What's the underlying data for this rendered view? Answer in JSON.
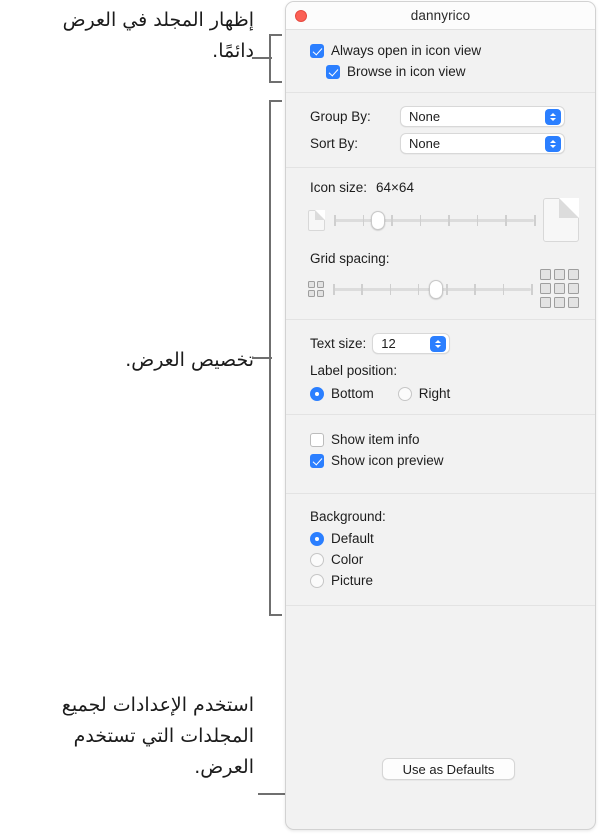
{
  "window": {
    "title": "dannyrico",
    "close_icon": "close-button-red"
  },
  "view_options": {
    "always_open_icon_view": {
      "label": "Always open in icon view",
      "checked": true
    },
    "browse_icon_view": {
      "label": "Browse in icon view",
      "checked": true
    },
    "group_by": {
      "label": "Group By:",
      "value": "None"
    },
    "sort_by": {
      "label": "Sort By:",
      "value": "None"
    },
    "icon_size": {
      "label": "Icon size:",
      "value": "64×64",
      "slider_percent": 22
    },
    "grid_spacing": {
      "label": "Grid spacing:",
      "slider_percent": 52
    },
    "text_size": {
      "label": "Text size:",
      "value": "12"
    },
    "label_position": {
      "label": "Label position:",
      "options": [
        {
          "label": "Bottom",
          "selected": true
        },
        {
          "label": "Right",
          "selected": false
        }
      ]
    },
    "show_item_info": {
      "label": "Show item info",
      "checked": false
    },
    "show_icon_preview": {
      "label": "Show icon preview",
      "checked": true
    },
    "background": {
      "label": "Background:",
      "options": [
        {
          "label": "Default",
          "selected": true
        },
        {
          "label": "Color",
          "selected": false
        },
        {
          "label": "Picture",
          "selected": false
        }
      ]
    },
    "use_as_defaults": "Use as Defaults"
  },
  "annotations": {
    "always_open": "إظهار المجلد في العرض دائمًا.",
    "customize_view": "تخصيص العرض.",
    "use_defaults": "استخدم الإعدادات لجميع المجلدات التي تستخدم العرض."
  },
  "colors": {
    "accent": "#2b7fff",
    "close": "#fb6055",
    "panel": "#f2f2f2",
    "annotation_line": "#6f6f6f"
  }
}
